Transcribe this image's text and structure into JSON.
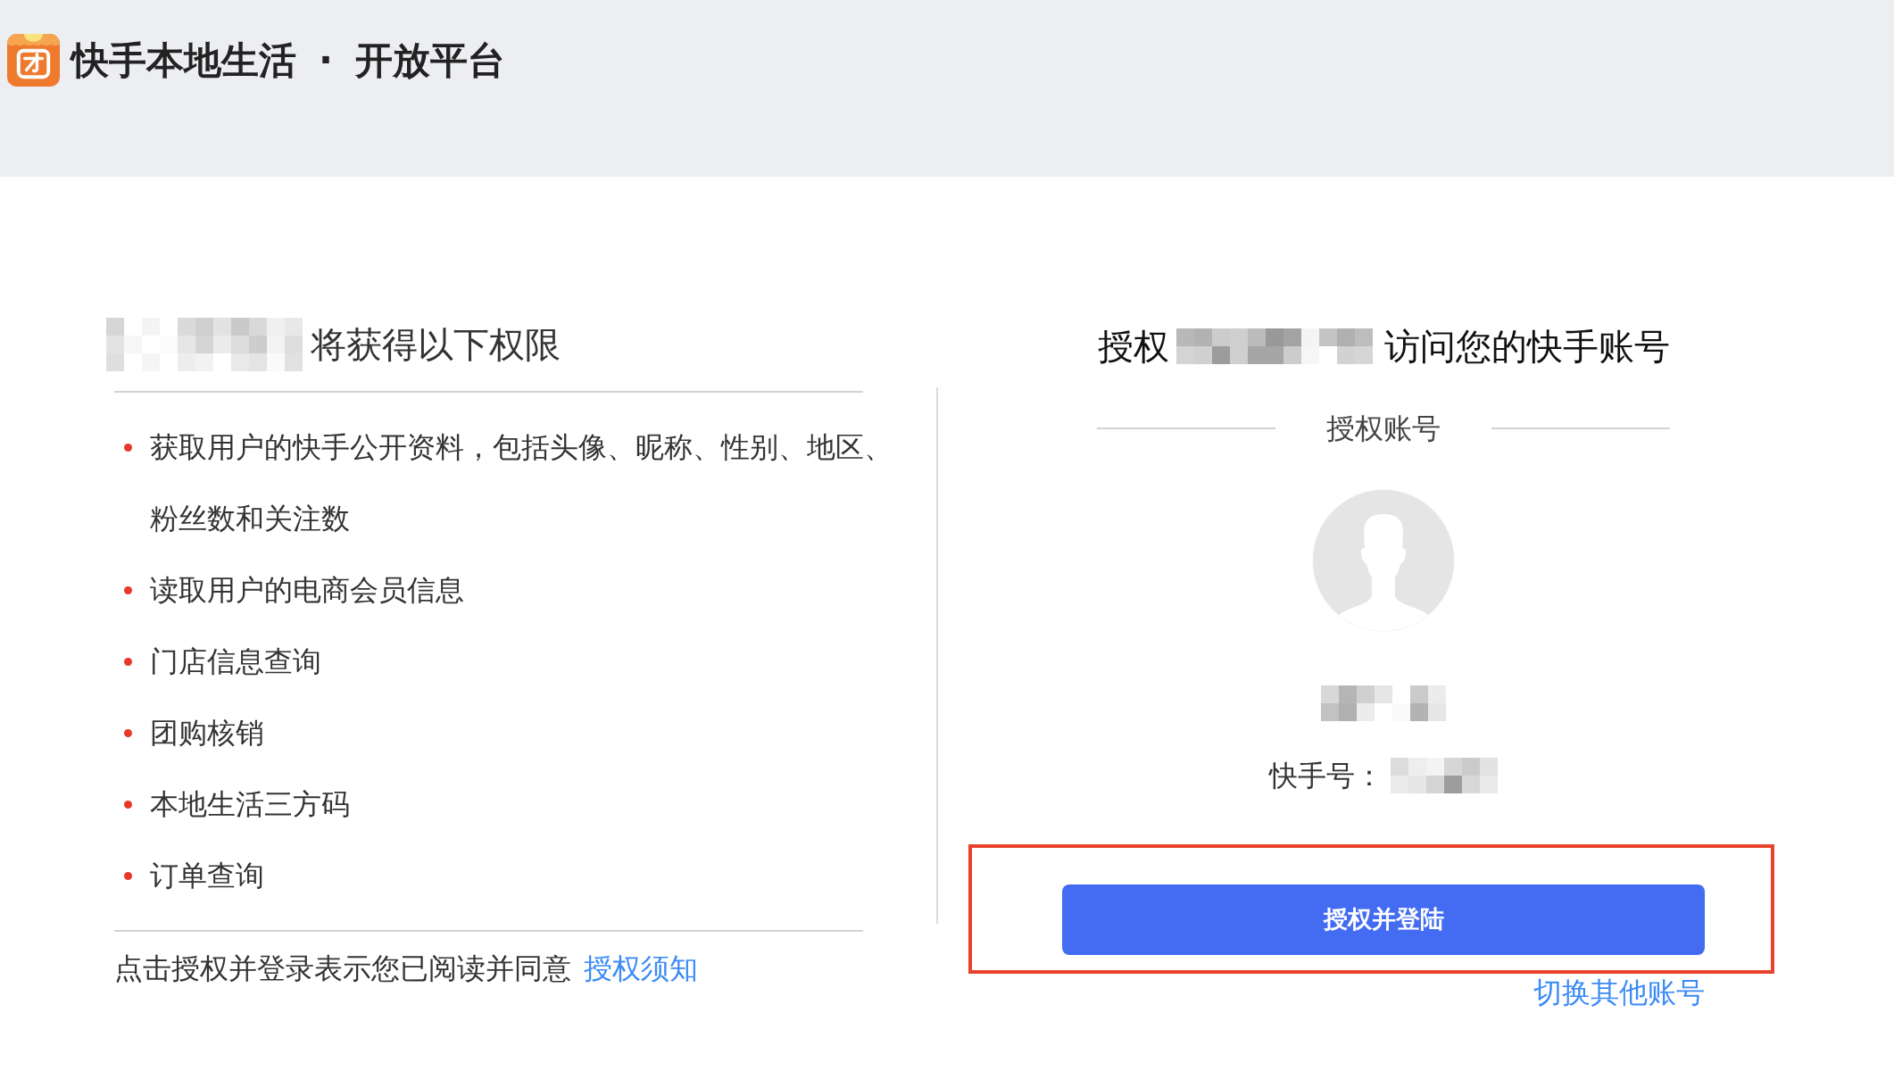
{
  "header": {
    "brand": "快手本地生活",
    "separator": "·",
    "platform": "开放平台"
  },
  "permissions": {
    "heading": "将获得以下权限",
    "items": [
      "获取用户的快手公开资料，包括头像、昵称、性别、地区、粉丝数和关注数",
      "读取用户的电商会员信息",
      "门店信息查询",
      "团购核销",
      "本地生活三方码",
      "订单查询"
    ],
    "consent": {
      "text": "点击授权并登录表示您已阅读并同意",
      "link": "授权须知"
    }
  },
  "authorization": {
    "heading_prefix": "授权",
    "heading_suffix": "访问您的快手账号",
    "section_label": "授权账号",
    "account_id_label": "快手号：",
    "login_button": {
      "label": "授权并登陆",
      "highlighted": true
    },
    "switch_link": "切换其他账号"
  }
}
